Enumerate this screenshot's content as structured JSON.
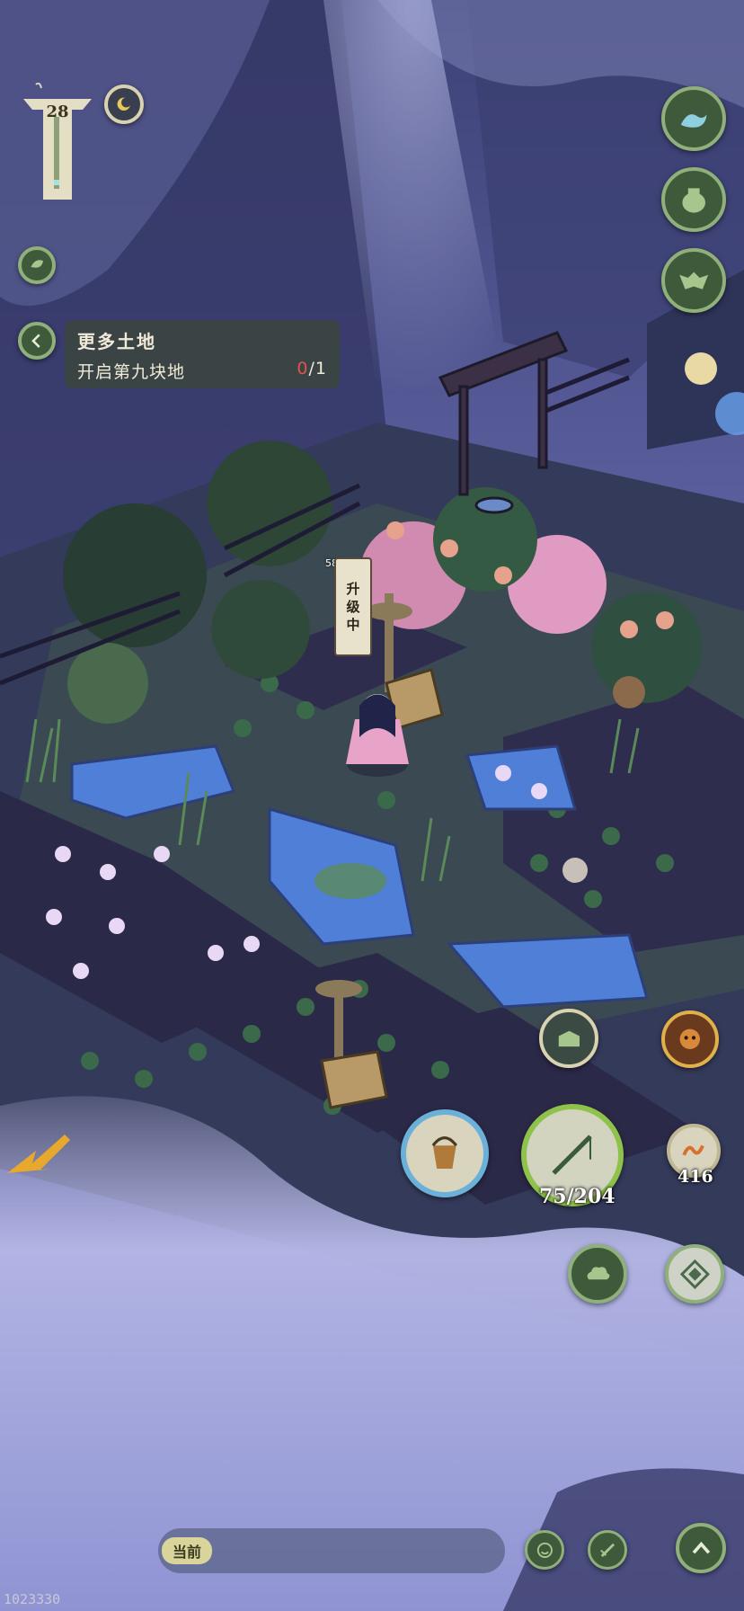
{
  "hud": {
    "level": "28",
    "build_id": "1023330"
  },
  "quest": {
    "title": "更多土地",
    "description": "开启第九块地",
    "progress_current": "0",
    "progress_total": "/1"
  },
  "building": {
    "timer": "58分32秒",
    "status_line1": "升",
    "status_line2": "级",
    "status_line3": "中"
  },
  "action_bar": {
    "stamina": "75/204",
    "bait_count": "416"
  },
  "chat": {
    "channel_label": "当前"
  },
  "icons": {
    "right_top_1": "wave-icon",
    "right_top_2": "jar-icon",
    "right_top_3": "bat-mask-icon",
    "bucket": "bucket-icon",
    "fishing_rod": "fishing-rod-icon",
    "worm_bait": "worm-icon",
    "storage_box": "storage-box-icon",
    "monkey_pet": "monkey-face-icon",
    "cloud": "cloud-icon",
    "compass": "compass-icon",
    "emoji": "smile-icon",
    "write": "brush-icon",
    "expand": "chevron-up-icon"
  },
  "colors": {
    "button_fill": "#3f5a3a",
    "button_ring": "#8fb07a",
    "progress_red": "#e0534a",
    "water": "#4f7fd6",
    "fog": "#b7b9e8"
  }
}
